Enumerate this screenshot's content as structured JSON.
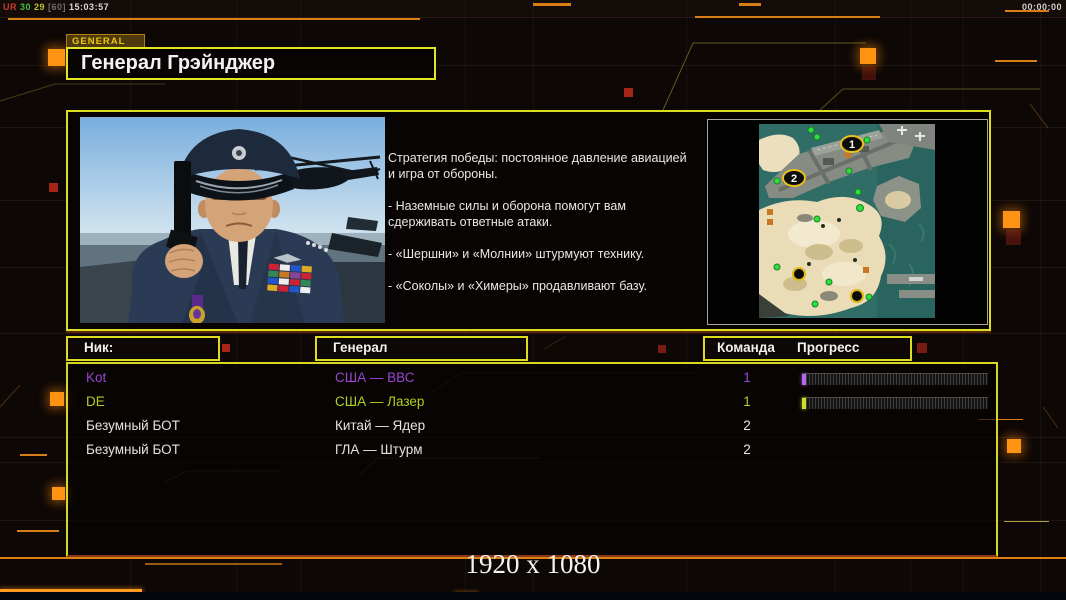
{
  "hud": {
    "debug_ur": "UR",
    "debug_fps": "30",
    "debug_val": "29",
    "debug_bracket": "[60]",
    "debug_time": "15:03:57",
    "match_timer": "00:00:00"
  },
  "header": {
    "tab_label": "GENERAL",
    "title": "Генерал Грэйнджер"
  },
  "briefing": {
    "p1": "Стратегия победы: постоянное давление авиацией\n и игра от обороны.",
    "p2": "- Наземные силы и оборона помогут вам\n сдерживать ответные атаки.",
    "p3": "- «Шершни» и «Молнии» штурмуют технику.",
    "p4": "- «Соколы» и «Химеры» продавливают базу."
  },
  "minimap": {
    "markers": [
      "1",
      "2"
    ]
  },
  "lobby_table": {
    "headers": {
      "nick": "Ник:",
      "general": "Генерал",
      "team": "Команда",
      "progress": "Прогресс"
    },
    "rows": [
      {
        "nick": "Kot",
        "general": "США — ВВС",
        "team": "1"
      },
      {
        "nick": "DE",
        "general": "США — Лазер",
        "team": "1"
      },
      {
        "nick": "Безумный БОТ",
        "general": "Китай — Ядер",
        "team": "2"
      },
      {
        "nick": "Безумный БОТ",
        "general": "ГЛА — Штурм",
        "team": "2"
      }
    ]
  },
  "footer": {
    "resolution": "1920 x 1080"
  },
  "colors": {
    "panel_border_yellow": "#dede20",
    "accent_orange": "#d97d16",
    "bright_orange_square": "#ff9414",
    "player1_purple": "#9a46d2",
    "player2_green": "#aed122",
    "bot_white": "#e4e4e4",
    "tab_text_yellow": "#ecc614"
  }
}
